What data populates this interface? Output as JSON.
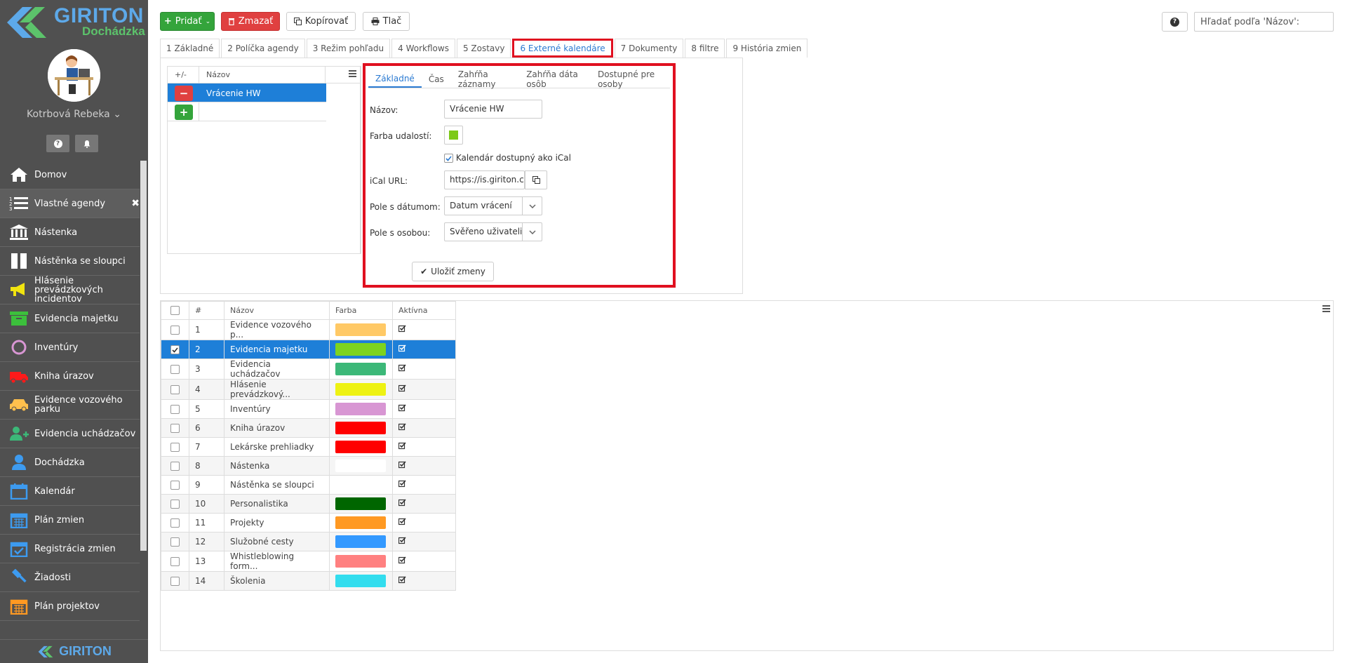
{
  "brand": {
    "name": "GIRITON",
    "product": "Dochádzka"
  },
  "user": {
    "name": "Kotrbová Rebeka"
  },
  "sidebar": {
    "items": [
      {
        "label": "Domov",
        "icon": "home-icon"
      },
      {
        "label": "Vlastné agendy",
        "icon": "list-icon",
        "active": true
      },
      {
        "label": "Nástenka",
        "icon": "bank-icon"
      },
      {
        "label": "Nástěnka se sloupci",
        "icon": "columns-icon"
      },
      {
        "label": "Hlásenie prevádzkových incidentov",
        "icon": "megaphone-icon"
      },
      {
        "label": "Evidencia majetku",
        "icon": "box-icon"
      },
      {
        "label": "Inventúry",
        "icon": "circle-icon"
      },
      {
        "label": "Kniha úrazov",
        "icon": "ambulance-icon"
      },
      {
        "label": "Evidence vozového parku",
        "icon": "car-icon"
      },
      {
        "label": "Evidencia uchádzačov",
        "icon": "user-plus-icon"
      },
      {
        "label": "Dochádzka",
        "icon": "user-icon"
      },
      {
        "label": "Kalendár",
        "icon": "calendar-icon"
      },
      {
        "label": "Plán zmien",
        "icon": "calendar-grid-icon"
      },
      {
        "label": "Registrácia zmien",
        "icon": "calendar-check-icon"
      },
      {
        "label": "Žiadosti",
        "icon": "gavel-icon"
      },
      {
        "label": "Plán projektov",
        "icon": "calendar-orange-icon"
      }
    ]
  },
  "toolbar": {
    "add": "Pridať",
    "delete": "Zmazať",
    "copy": "Kopírovať",
    "print": "Tlač",
    "search_placeholder": "Hľadať podľa 'Názov':"
  },
  "tabs": [
    "1 Základné",
    "2 Políčka agendy",
    "3 Režim pohľadu",
    "4 Workflows",
    "5 Zostavy",
    "6 Externé kalendáre",
    "7 Dokumenty",
    "8 filtre",
    "9 História zmien"
  ],
  "mini_grid": {
    "col1": "+/-",
    "col2": "Názov",
    "row": "Vrácenie HW"
  },
  "form": {
    "subtabs": [
      "Základné",
      "Čas",
      "Zahŕňa záznamy",
      "Zahŕňa dáta osôb",
      "Dostupné pre osoby"
    ],
    "name_label": "Názov:",
    "name_value": "Vrácenie HW",
    "color_label": "Farba udalostí:",
    "color_value": "#7dc918",
    "ical_check_label": "Kalendár dostupný ako iCal",
    "ical_label": "iCal URL:",
    "ical_value": "https://is.giriton.com/s",
    "date_label": "Pole s dátumom:",
    "date_value": "Datum vrácení",
    "person_label": "Pole s osobou:",
    "person_value": "Svěřeno uživateli",
    "save": "Uložiť zmeny"
  },
  "grid": {
    "headers": [
      "#",
      "Názov",
      "Farba",
      "Aktívna"
    ],
    "rows": [
      {
        "n": "1",
        "name": "Evidence vozového p...",
        "color": "#ffc966"
      },
      {
        "n": "2",
        "name": "Evidencia majetku",
        "color": "#7dd31f",
        "selected": true
      },
      {
        "n": "3",
        "name": "Evidencia uchádzačov",
        "color": "#3cb878"
      },
      {
        "n": "4",
        "name": "Hlásenie prevádzkový...",
        "color": "#eef213"
      },
      {
        "n": "5",
        "name": "Inventúry",
        "color": "#d896d3"
      },
      {
        "n": "6",
        "name": "Kniha úrazov",
        "color": "#ff0000"
      },
      {
        "n": "7",
        "name": "Lekárske prehliadky",
        "color": "#ff0000"
      },
      {
        "n": "8",
        "name": "Nástenka",
        "color": "#ffffff"
      },
      {
        "n": "9",
        "name": "Nástěnka se sloupci",
        "color": ""
      },
      {
        "n": "10",
        "name": "Personalistika",
        "color": "#006600"
      },
      {
        "n": "11",
        "name": "Projekty",
        "color": "#ff9922"
      },
      {
        "n": "12",
        "name": "Služobné cesty",
        "color": "#3399ff"
      },
      {
        "n": "13",
        "name": "Whistleblowing form...",
        "color": "#ff8080"
      },
      {
        "n": "14",
        "name": "Školenia",
        "color": "#33ddee"
      }
    ]
  }
}
